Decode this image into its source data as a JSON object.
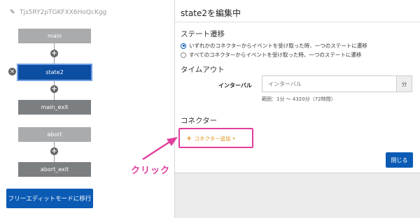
{
  "flow": {
    "name": "Tjs5RY2pTGKFXX6HoQcKgg",
    "nodes": {
      "main": "main",
      "state2": "state2",
      "main_exit": "main_exit",
      "abort": "abort",
      "abort_exit": "abort_exit"
    },
    "free_edit_label": "フリーエディットモードに移行"
  },
  "panel": {
    "title": "state2を編集中",
    "transition": {
      "heading": "ステート遷移",
      "option_any": "いずれかのコネクターからイベントを受け取った時、一つのステートに遷移",
      "option_all": "すべてのコネクターからイベントを受け取った時、一つのステートに遷移",
      "selected": "option_any"
    },
    "timeout": {
      "heading": "タイムアウト",
      "interval_label": "インターバル",
      "interval_placeholder": "インターバル",
      "unit": "分",
      "range": "範囲：1分 〜 4320分（72時間）"
    },
    "connector": {
      "heading": "コネクター",
      "add_label": "コネクター追加"
    },
    "close_label": "閉じる"
  },
  "annotation": {
    "click_text": "クリック",
    "color": "#e0409c"
  }
}
